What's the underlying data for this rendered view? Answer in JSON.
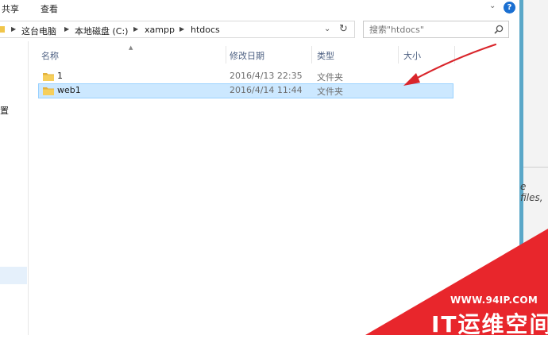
{
  "ribbon": {
    "tabs": [
      "共享",
      "查看"
    ],
    "help_label": "?"
  },
  "address": {
    "breadcrumbs": [
      "这台电脑",
      "本地磁盘 (C:)",
      "xampp",
      "htdocs"
    ],
    "refresh_glyph": "↻",
    "dropdown_glyph": "⌄"
  },
  "search": {
    "placeholder": "搜索\"htdocs\""
  },
  "nav": {
    "fragment": "置"
  },
  "columns": {
    "name": "名称",
    "date": "修改日期",
    "type": "类型",
    "size": "大小"
  },
  "files": [
    {
      "name": "1",
      "date": "2016/4/13 22:35",
      "type": "文件夹",
      "size": "",
      "selected": false
    },
    {
      "name": "web1",
      "date": "2016/4/14 11:44",
      "type": "文件夹",
      "size": "",
      "selected": true
    }
  ],
  "background": {
    "fragment": "e files,"
  },
  "watermark": {
    "url": "WWW.94IP.COM",
    "text": "IT运维空间"
  },
  "colors": {
    "selection": "#cce8ff",
    "arrow": "#d9252b",
    "folder": "#f0c54a",
    "watermark_red": "#e8262c"
  }
}
